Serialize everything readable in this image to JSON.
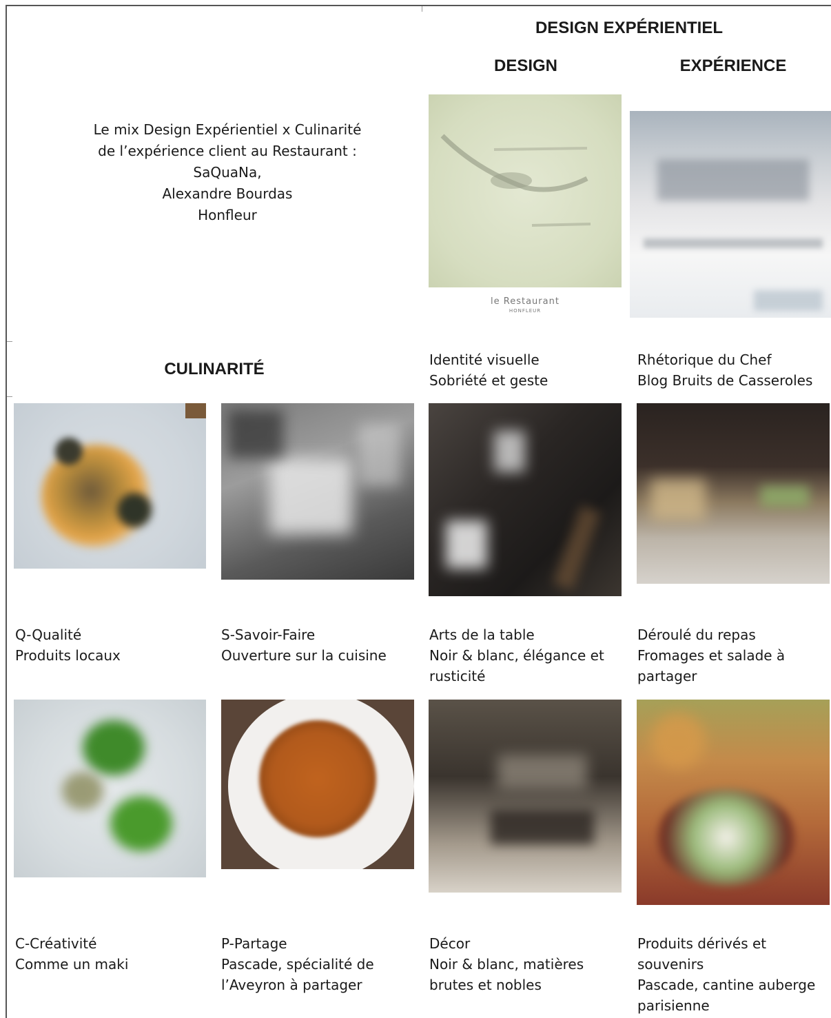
{
  "headings": {
    "design_experientiel": "DESIGN EXPÉRIENTIEL",
    "design": "DESIGN",
    "experience": "EXPÉRIENCE",
    "culinarite": "CULINARITÉ"
  },
  "intro": {
    "lines": [
      "Le mix Design Expérientiel x Culinarité",
      "de l’expérience client au Restaurant :",
      "SaQuaNa,",
      "Alexandre Bourdas",
      "Honfleur"
    ]
  },
  "logo": {
    "name": "le Restaurant",
    "city": "HONFLEUR"
  },
  "photos": [
    {
      "id": "logo-design",
      "caption": [
        "Identité visuelle",
        "Sobriété et geste"
      ]
    },
    {
      "id": "blog",
      "caption": [
        "Rhétorique du Chef",
        "Blog Bruits de Casseroles"
      ]
    },
    {
      "id": "qualite",
      "caption": [
        "Q-Qualité",
        "Produits locaux"
      ]
    },
    {
      "id": "savoir-faire",
      "caption": [
        "S-Savoir-Faire",
        "Ouverture sur la cuisine"
      ]
    },
    {
      "id": "arts-table",
      "caption": [
        "Arts de la table",
        "Noir & blanc, élégance et",
        "rusticité"
      ]
    },
    {
      "id": "deroule",
      "caption": [
        "Déroulé du repas",
        "Fromages et salade à",
        "partager"
      ]
    },
    {
      "id": "creativite",
      "caption": [
        "C-Créativité",
        "Comme un maki"
      ]
    },
    {
      "id": "partage",
      "caption": [
        "P-Partage",
        "Pascade, spécialité de",
        "l’Aveyron à partager"
      ]
    },
    {
      "id": "decor",
      "caption": [
        "Décor",
        "Noir & blanc, matières",
        "brutes et nobles"
      ]
    },
    {
      "id": "produits",
      "caption": [
        "Produits dérivés et",
        "souvenirs",
        "Pascade, cantine auberge",
        "parisienne"
      ]
    }
  ]
}
